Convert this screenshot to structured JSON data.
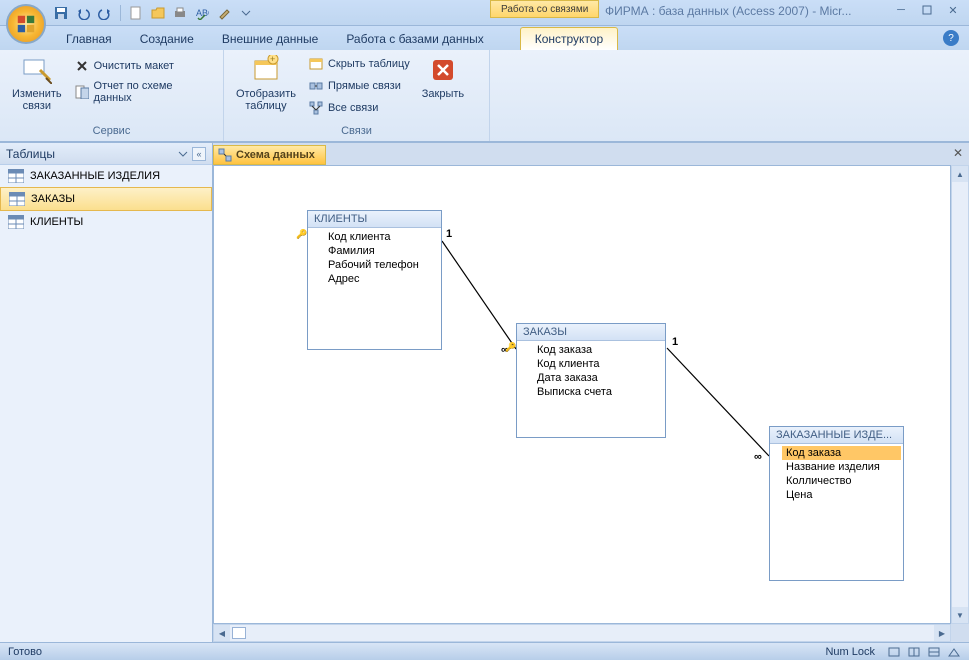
{
  "titlebar": {
    "contextual_title": "Работа со связями",
    "app_title": "ФИРМА : база данных (Access 2007) - Micr..."
  },
  "tabs": {
    "home": "Главная",
    "create": "Создание",
    "external": "Внешние данные",
    "dbtools": "Работа с базами данных",
    "design": "Конструктор"
  },
  "ribbon": {
    "edit_relations": "Изменить\nсвязи",
    "clear_layout": "Очистить макет",
    "relationship_report": "Отчет по схеме данных",
    "group_tools": "Сервис",
    "show_table": "Отобразить\nтаблицу",
    "hide_table": "Скрыть таблицу",
    "direct_relations": "Прямые связи",
    "all_relations": "Все связи",
    "close": "Закрыть",
    "group_relations": "Связи"
  },
  "nav": {
    "title": "Таблицы",
    "items": [
      {
        "label": "ЗАКАЗАННЫЕ ИЗДЕЛИЯ"
      },
      {
        "label": "ЗАКАЗЫ"
      },
      {
        "label": "КЛИЕНТЫ"
      }
    ]
  },
  "doc_tab": "Схема данных",
  "tables": {
    "clients": {
      "name": "КЛИЕНТЫ",
      "fields": [
        "Код клиента",
        "Фамилия",
        "Рабочий телефон",
        "Адрес"
      ]
    },
    "orders": {
      "name": "ЗАКАЗЫ",
      "fields": [
        "Код заказа",
        "Код клиента",
        "Дата заказа",
        "Выписка счета"
      ]
    },
    "order_items": {
      "name": "ЗАКАЗАННЫЕ ИЗДЕ...",
      "fields": [
        "Код заказа",
        "Название изделия",
        "Колличество",
        "Цена"
      ]
    }
  },
  "relation_labels": {
    "one": "1",
    "many": "∞"
  },
  "status": {
    "ready": "Готово",
    "numlock": "Num Lock"
  }
}
